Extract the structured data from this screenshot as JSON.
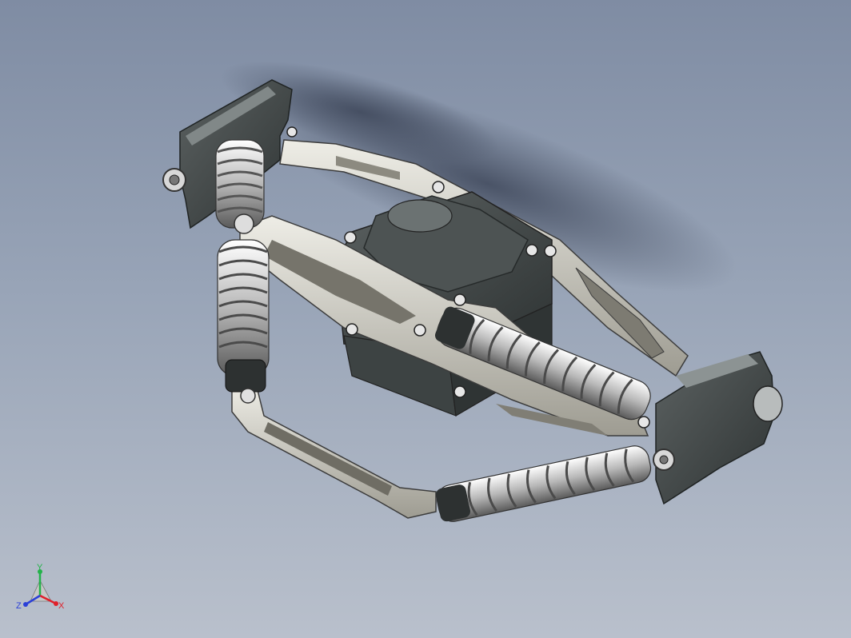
{
  "viewport": {
    "background_top": "#7f8ca3",
    "background_bottom": "#b9c0cc"
  },
  "model": {
    "description_icon": "suspension-assembly",
    "body_color": "#4a5050",
    "arm_color": "#c9c7bd",
    "spring_color": "#e8e8e8"
  },
  "triad": {
    "x_label": "X",
    "y_label": "Y",
    "z_label": "Z",
    "x_color": "#e0202a",
    "y_color": "#23b24a",
    "z_color": "#2a3fd8"
  }
}
